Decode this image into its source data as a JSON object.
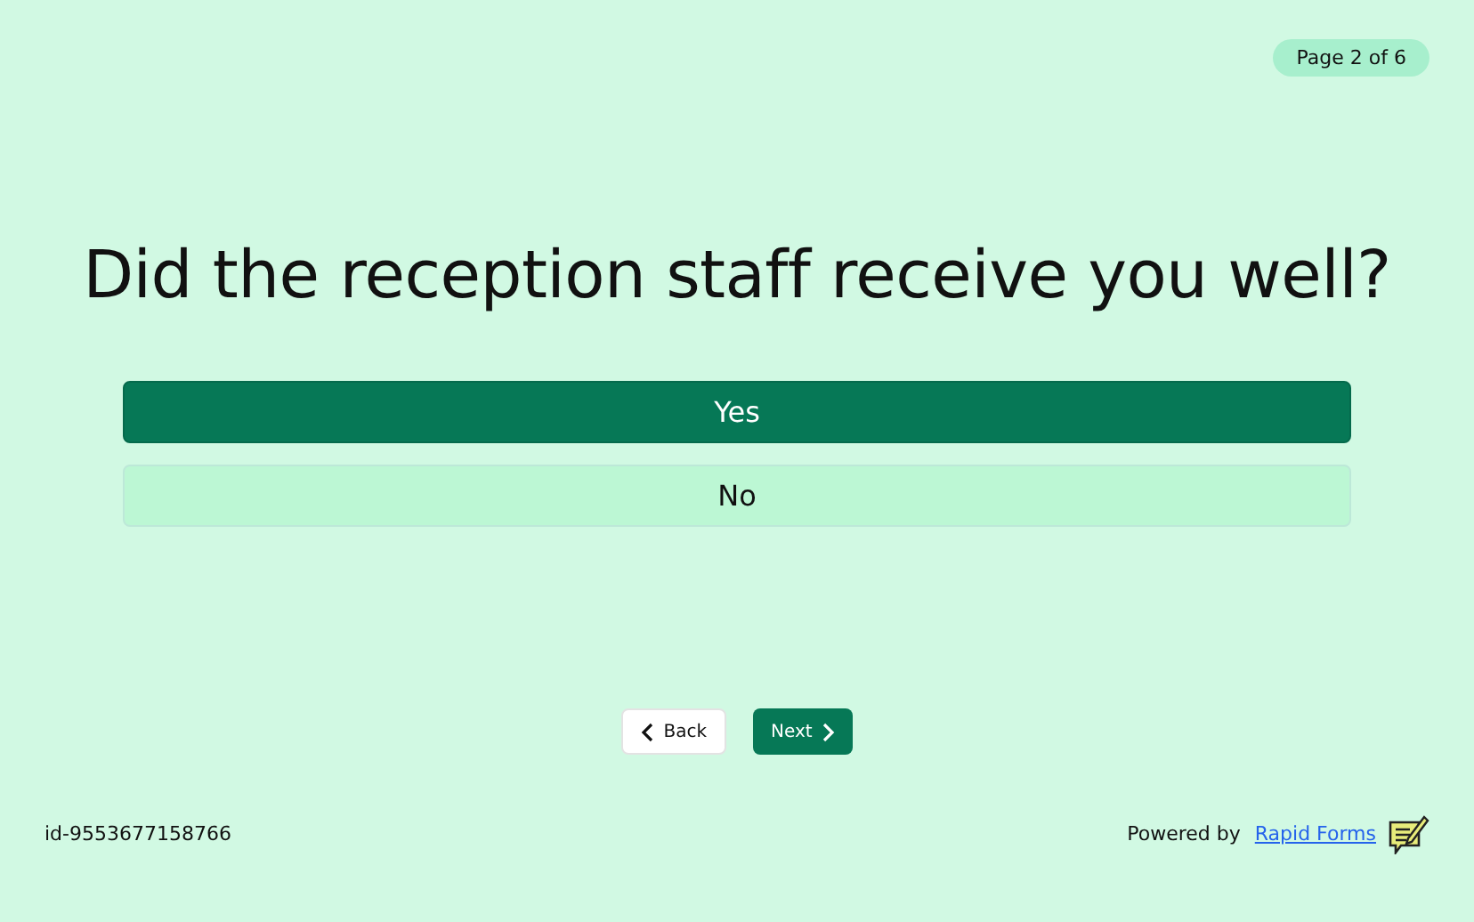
{
  "page_indicator": "Page 2 of 6",
  "question": "Did the reception staff receive you well?",
  "options": [
    {
      "label": "Yes",
      "selected": true
    },
    {
      "label": "No",
      "selected": false
    }
  ],
  "nav": {
    "back": "Back",
    "next": "Next"
  },
  "footer": {
    "response_id": "id-9553677158766",
    "powered_by": "Powered by",
    "brand_link": "Rapid Forms"
  }
}
